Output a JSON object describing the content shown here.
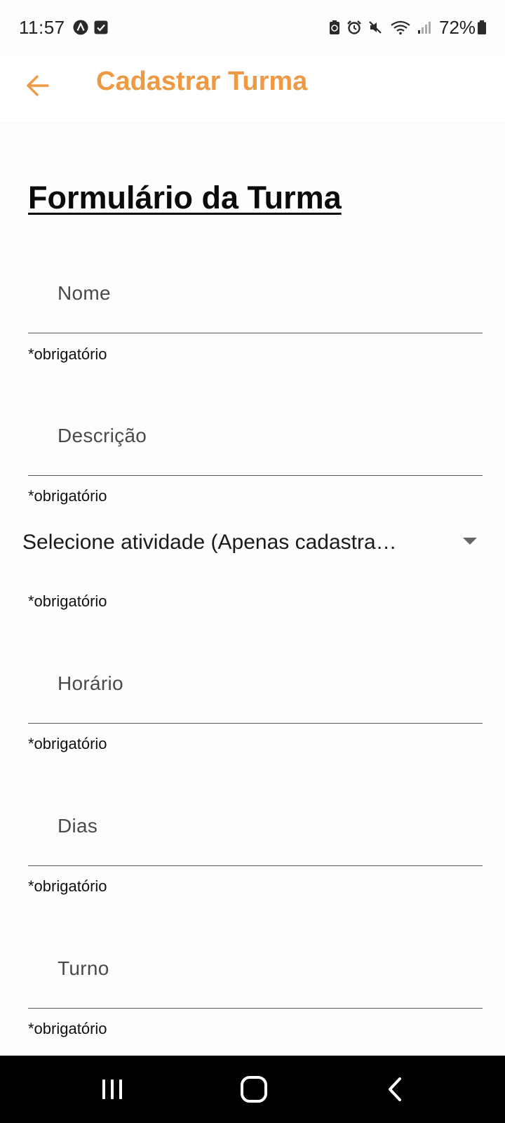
{
  "status_bar": {
    "time": "11:57",
    "battery": "72%",
    "left_icons": [
      "app-a-icon",
      "checkbox-notification-icon"
    ],
    "right_icons": [
      "battery-saver-icon",
      "alarm-icon",
      "mute-icon",
      "wifi-icon",
      "signal-icon",
      "battery-icon"
    ]
  },
  "app_bar": {
    "title": "Cadastrar Turma",
    "back_icon": "arrow-back-icon",
    "accent_color": "#EE9A45"
  },
  "form": {
    "heading": "Formulário da Turma",
    "nome": {
      "label": "Nome",
      "helper": "*obrigatório"
    },
    "descricao": {
      "label": "Descrição",
      "helper": "*obrigatório"
    },
    "atividade": {
      "value": "Selecione atividade (Apenas cadastra…",
      "helper": "*obrigatório"
    },
    "horario": {
      "label": "Horário",
      "helper": "*obrigatório"
    },
    "dias": {
      "label": "Dias",
      "helper": "*obrigatório"
    },
    "turno": {
      "label": "Turno",
      "helper": "*obrigatório"
    }
  },
  "nav_bar": {
    "buttons": [
      "recent-apps-icon",
      "home-icon",
      "back-icon"
    ]
  }
}
